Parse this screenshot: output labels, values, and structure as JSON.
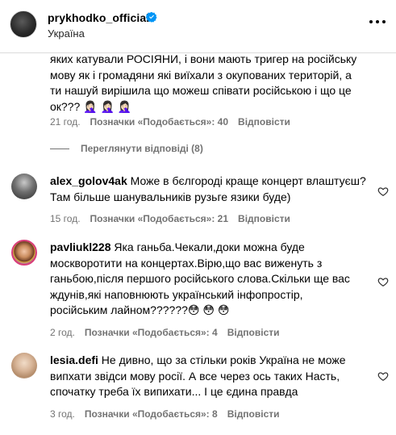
{
  "header": {
    "username": "prykhodko_official",
    "location": "Україна",
    "icons": {
      "verified": "verified-badge-icon",
      "more": "more-options-icon",
      "avatar": "profile-avatar"
    },
    "verified_color": "#0095f6"
  },
  "first_comment": {
    "text_lines": [
      "яких катували РОСІЯНИ, і вони мають тригер на російську",
      "мову як і громадяни які виїхали з окупованих територій, а",
      "ти нашуй вирішила що можеш співати російською і що це",
      "ок??? 🤦🏻‍♀️ 🤦🏻‍♀️ 🤦🏻‍♀️"
    ],
    "time": "21 год.",
    "likes": "Позначки «Подобається»: 40",
    "reply": "Відповісти"
  },
  "view_replies": "Переглянути відповіді (8)",
  "comments": [
    {
      "username": "alex_golov4ak",
      "text_first": " Може в бєлгороді краще концерт влаштуєш?",
      "text_rest": [
        "Там більше шанувальників рузьге язики буде)"
      ],
      "time": "15 год.",
      "likes": "Позначки «Подобається»: 21",
      "reply": "Відповісти"
    },
    {
      "username": "pavliukl228",
      "text_first": " Яка ганьба.Чекали,доки можна буде",
      "text_rest": [
        "москворотити на концертах.Вірю,що вас виженуть з",
        "ганьбою,після першого російського слова.Скільки ще вас",
        "ждунів,які наповнюють український інфопростір,",
        "російським лайном??????😳 😳 😳"
      ],
      "time": "2 год.",
      "likes": "Позначки «Подобається»: 4",
      "reply": "Відповісти"
    },
    {
      "username": "lesia.defi",
      "text_first": " Не дивно, що за стільки років Україна не може",
      "text_rest": [
        "випхати звідси мову росії. А все через ось таких Насть,",
        "спочатку треба їх випихати... І це єдина правда"
      ],
      "time": "3 год.",
      "likes": "Позначки «Подобається»: 8",
      "reply": "Відповісти"
    }
  ],
  "colors": {
    "secondary_text": "#737373",
    "divider": "#dbdbdb"
  }
}
